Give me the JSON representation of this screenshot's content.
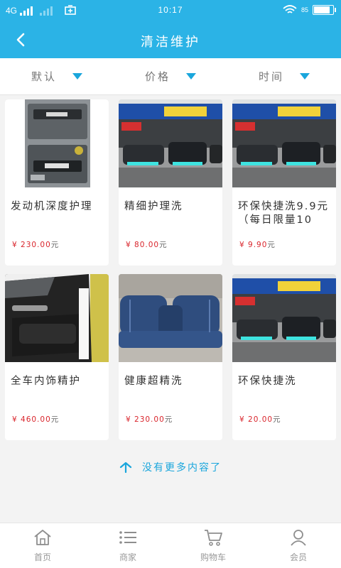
{
  "status_bar": {
    "network": "4G",
    "time": "10:17",
    "battery": "85"
  },
  "header": {
    "title": "清洁维护"
  },
  "sort_bar": {
    "items": [
      {
        "label": "默认"
      },
      {
        "label": "价格"
      },
      {
        "label": "时间"
      }
    ]
  },
  "products": [
    {
      "name": "发动机深度护理",
      "price": "¥ 230.00",
      "unit": "元"
    },
    {
      "name": "精细护理洗",
      "price": "¥ 80.00",
      "unit": "元"
    },
    {
      "name": "环保快捷洗9.9元（每日限量10",
      "price": "¥ 9.90",
      "unit": "元"
    },
    {
      "name": "全车内饰精护",
      "price": "¥ 460.00",
      "unit": "元"
    },
    {
      "name": "健康超精洗",
      "price": "¥ 230.00",
      "unit": "元"
    },
    {
      "name": "环保快捷洗",
      "price": "¥ 20.00",
      "unit": "元"
    }
  ],
  "footer_text": "没有更多内容了",
  "bottom_nav": [
    {
      "label": "首页",
      "icon": "home-icon"
    },
    {
      "label": "商家",
      "icon": "list-icon"
    },
    {
      "label": "购物车",
      "icon": "cart-icon"
    },
    {
      "label": "会员",
      "icon": "user-icon"
    }
  ]
}
